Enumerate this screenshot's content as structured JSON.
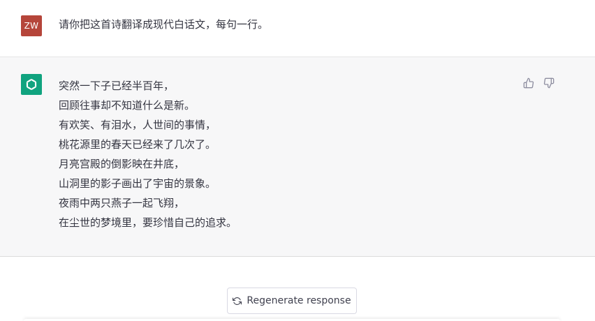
{
  "user_message": {
    "avatar_initials": "ZW",
    "avatar_color": "#b5453a",
    "text": "请你把这首诗翻译成现代白话文，每句一行。"
  },
  "assistant_message": {
    "avatar_icon": "openai-logo-icon",
    "avatar_color": "#10a37f",
    "lines": [
      "突然一下子已经半百年，",
      "回顾往事却不知道什么是新。",
      "有欢笑、有泪水，人世间的事情，",
      "桃花源里的春天已经来了几次了。",
      "月亮宫殿的倒影映在井底，",
      "山洞里的影子画出了宇宙的景象。",
      "夜雨中两只燕子一起飞翔，",
      "在尘世的梦境里，要珍惜自己的追求。"
    ],
    "feedback": {
      "thumbs_up_icon": "thumbs-up-icon",
      "thumbs_down_icon": "thumbs-down-icon"
    }
  },
  "actions": {
    "regenerate_label": "Regenerate response",
    "regenerate_icon": "refresh-icon"
  }
}
